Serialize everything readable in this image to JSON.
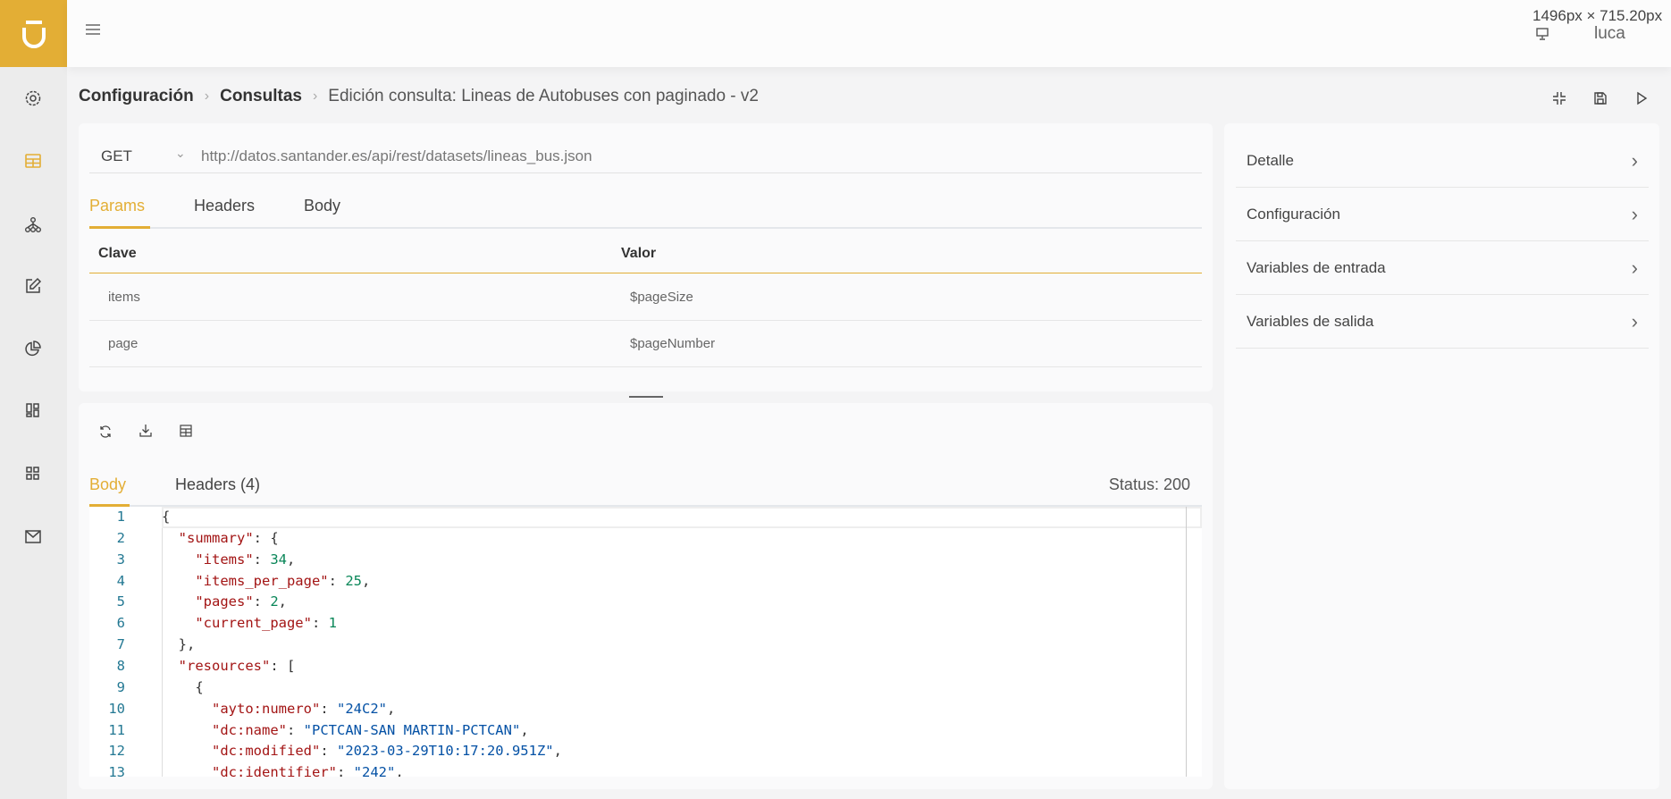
{
  "topbar": {
    "viewport_size": "1496px × 715.20px",
    "user": "luca"
  },
  "breadcrumb": {
    "items": [
      "Configuración",
      "Consultas"
    ],
    "current": "Edición consulta: Lineas de Autobuses con paginado - v2"
  },
  "request": {
    "method": "GET",
    "url": "http://datos.santander.es/api/rest/datasets/lineas_bus.json",
    "tabs": [
      "Params",
      "Headers",
      "Body"
    ],
    "params": {
      "headers": [
        "Clave",
        "Valor"
      ],
      "rows": [
        {
          "key": "items",
          "value": "$pageSize"
        },
        {
          "key": "page",
          "value": "$pageNumber"
        }
      ]
    }
  },
  "response": {
    "tabs": [
      "Body",
      "Headers (4)"
    ],
    "status": "Status: 200",
    "lines": [
      {
        "n": "1",
        "html": "{"
      },
      {
        "n": "2",
        "html": "  <span class='k'>\"summary\"</span>: {"
      },
      {
        "n": "3",
        "html": "    <span class='k'>\"items\"</span>: <span class='n'>34</span>,"
      },
      {
        "n": "4",
        "html": "    <span class='k'>\"items_per_page\"</span>: <span class='n'>25</span>,"
      },
      {
        "n": "5",
        "html": "    <span class='k'>\"pages\"</span>: <span class='n'>2</span>,"
      },
      {
        "n": "6",
        "html": "    <span class='k'>\"current_page\"</span>: <span class='n'>1</span>"
      },
      {
        "n": "7",
        "html": "  },"
      },
      {
        "n": "8",
        "html": "  <span class='k'>\"resources\"</span>: ["
      },
      {
        "n": "9",
        "html": "    {"
      },
      {
        "n": "10",
        "html": "      <span class='k'>\"ayto:numero\"</span>: <span class='s'>\"24C2\"</span>,"
      },
      {
        "n": "11",
        "html": "      <span class='k'>\"dc:name\"</span>: <span class='s'>\"PCTCAN-SAN MARTIN-PCTCAN\"</span>,"
      },
      {
        "n": "12",
        "html": "      <span class='k'>\"dc:modified\"</span>: <span class='s'>\"2023-03-29T10:17:20.951Z\"</span>,"
      },
      {
        "n": "13",
        "html": "      <span class='k'>\"dc:identifier\"</span>: <span class='s'>\"242\"</span>,"
      }
    ]
  },
  "side_panel": {
    "items": [
      "Detalle",
      "Configuración",
      "Variables de entrada",
      "Variables de salida"
    ]
  },
  "colors": {
    "accent": "#e3ae35"
  }
}
